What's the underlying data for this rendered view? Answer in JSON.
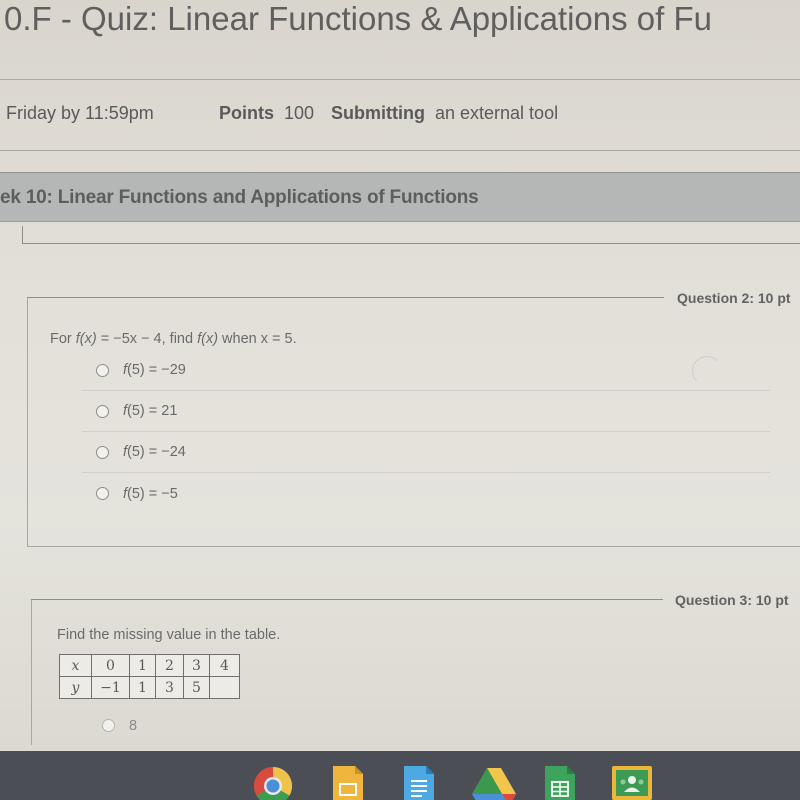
{
  "page": {
    "title": "0.F - Quiz: Linear Functions & Applications of Fu",
    "meta": {
      "due_label": "Friday by 11:59pm",
      "points_label": "Points",
      "points_value": "100",
      "submitting_label": "Submitting",
      "submitting_value": "an external tool"
    },
    "module_title": "ek 10: Linear Functions and Applications of Functions"
  },
  "questions": [
    {
      "label": "Question 2: 10 pt",
      "prompt": {
        "pre": "For ",
        "fx": "f(x)",
        "mid": " = −5x − 4, find ",
        "fx2": "f(x)",
        "post": " when x = 5."
      },
      "options": [
        {
          "fn": "f",
          "label": "(5) = −29",
          "selected": false
        },
        {
          "fn": "f",
          "label": "(5) = 21",
          "selected": false
        },
        {
          "fn": "f",
          "label": "(5) = −24",
          "selected": false
        },
        {
          "fn": "f",
          "label": "(5) = −5",
          "selected": false
        }
      ]
    },
    {
      "label": "Question 3: 10 pt",
      "prompt": "Find the missing value in the table.",
      "table": {
        "x_header": "x",
        "y_header": "y",
        "x": [
          "0",
          "1",
          "2",
          "3",
          "4"
        ],
        "y": [
          "−1",
          "1",
          "3",
          "5",
          ""
        ]
      },
      "options": [
        {
          "label": "8",
          "selected": false
        }
      ]
    }
  ],
  "taskbar": {
    "apps": [
      {
        "name": "Chrome",
        "icon": "chrome-icon"
      },
      {
        "name": "Google Slides",
        "icon": "slides-icon"
      },
      {
        "name": "Google Docs",
        "icon": "docs-icon"
      },
      {
        "name": "Google Drive",
        "icon": "drive-icon"
      },
      {
        "name": "Google Sheets",
        "icon": "sheets-icon"
      },
      {
        "name": "Google Classroom",
        "icon": "classroom-icon"
      }
    ]
  }
}
